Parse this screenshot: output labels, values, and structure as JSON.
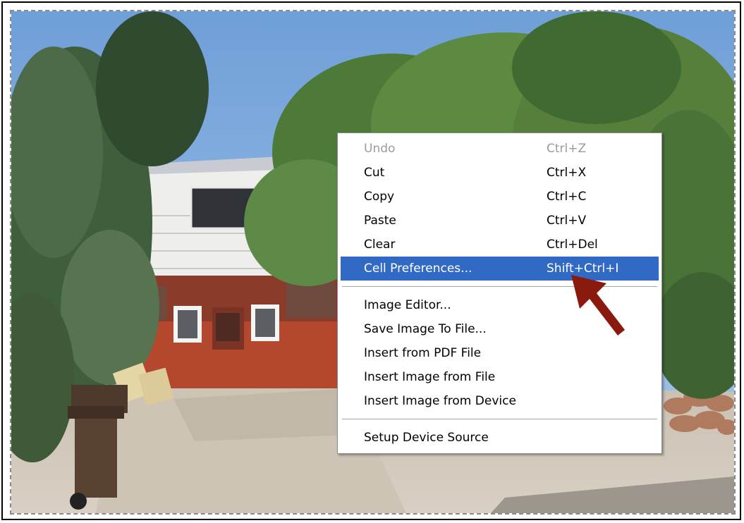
{
  "menu": {
    "groups": [
      [
        {
          "label": "Undo",
          "shortcut": "Ctrl+Z",
          "disabled": true
        },
        {
          "label": "Cut",
          "shortcut": "Ctrl+X"
        },
        {
          "label": "Copy",
          "shortcut": "Ctrl+C"
        },
        {
          "label": "Paste",
          "shortcut": "Ctrl+V"
        },
        {
          "label": "Clear",
          "shortcut": "Ctrl+Del"
        },
        {
          "label": "Cell Preferences...",
          "shortcut": "Shift+Ctrl+I",
          "highlighted": true
        }
      ],
      [
        {
          "label": "Image Editor...",
          "shortcut": ""
        },
        {
          "label": "Save Image To File...",
          "shortcut": ""
        },
        {
          "label": "Insert from PDF File",
          "shortcut": ""
        },
        {
          "label": "Insert Image from File",
          "shortcut": ""
        },
        {
          "label": "Insert Image from Device",
          "shortcut": ""
        }
      ],
      [
        {
          "label": "Setup Device Source",
          "shortcut": ""
        }
      ]
    ]
  },
  "colors": {
    "highlight": "#316ac5",
    "arrow": "#8b1a0e",
    "disabled_text": "#9b9b9b"
  },
  "icons": {
    "pointer": "arrow-pointer-icon"
  }
}
